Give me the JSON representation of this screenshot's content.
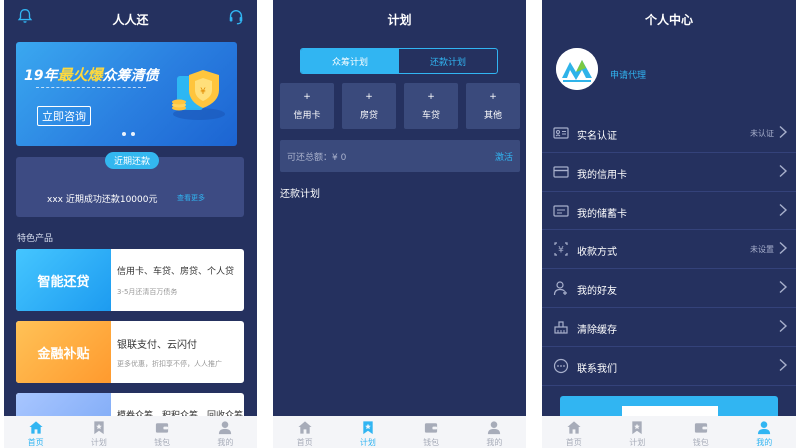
{
  "phone1": {
    "title": "人人还",
    "banner": {
      "title_prefix": "19年",
      "title_hot": "最火爆",
      "title_suffix": "众筹清债",
      "button": "立即咨询"
    },
    "repay": {
      "tag": "近期还款",
      "text": "xxx 近期成功还款10000元",
      "more": "查看更多"
    },
    "section_label": "特色产品",
    "products": [
      {
        "name": "智能还贷",
        "line1": "信用卡、车贷、房贷、个人贷",
        "line2": "3-5月还清百万债务"
      },
      {
        "name": "金融补贴",
        "line1": "银联支付、云闪付",
        "line2": "更多优惠，折扣享不停，人人推广"
      },
      {
        "name": "",
        "line1": "模券众筹、积积众筹、回收众筹",
        "line2": ""
      }
    ],
    "tabs": [
      {
        "label": "首页",
        "icon": "home-icon",
        "active": true
      },
      {
        "label": "计划",
        "icon": "bookmark-icon",
        "active": false
      },
      {
        "label": "钱包",
        "icon": "wallet-icon",
        "active": false
      },
      {
        "label": "我的",
        "icon": "user-icon",
        "active": false
      }
    ]
  },
  "phone2": {
    "title": "计划",
    "segments": [
      "众筹计划",
      "还款计划"
    ],
    "grid": [
      {
        "plus": "+",
        "label": "信用卡"
      },
      {
        "plus": "+",
        "label": "房贷"
      },
      {
        "plus": "+",
        "label": "车贷"
      },
      {
        "plus": "+",
        "label": "其他"
      }
    ],
    "balance_label": "可还总额：¥ 0",
    "balance_action": "激活",
    "plan_label": "还款计划",
    "tabs": [
      {
        "label": "首页",
        "icon": "home-icon",
        "active": false
      },
      {
        "label": "计划",
        "icon": "bookmark-icon",
        "active": true
      },
      {
        "label": "钱包",
        "icon": "wallet-icon",
        "active": false
      },
      {
        "label": "我的",
        "icon": "user-icon",
        "active": false
      }
    ]
  },
  "phone3": {
    "title": "个人中心",
    "apply": "申请代理",
    "menu": [
      {
        "label": "实名认证",
        "status": "未认证",
        "icon": "id-card-icon"
      },
      {
        "label": "我的信用卡",
        "status": "",
        "icon": "credit-card-icon"
      },
      {
        "label": "我的储蓄卡",
        "status": "",
        "icon": "debit-card-icon"
      },
      {
        "label": "收款方式",
        "status": "未设置",
        "icon": "yuan-icon"
      },
      {
        "label": "我的好友",
        "status": "",
        "icon": "friends-icon"
      },
      {
        "label": "清除缓存",
        "status": "",
        "icon": "clear-cache-icon"
      },
      {
        "label": "联系我们",
        "status": "",
        "icon": "chat-icon"
      }
    ],
    "tabs": [
      {
        "label": "首页",
        "icon": "home-icon",
        "active": false
      },
      {
        "label": "计划",
        "icon": "bookmark-icon",
        "active": false
      },
      {
        "label": "钱包",
        "icon": "wallet-icon",
        "active": false
      },
      {
        "label": "我的",
        "icon": "user-icon",
        "active": true
      }
    ]
  },
  "colors": {
    "background": "#25315f",
    "accent": "#31b5f2",
    "card": "#3d4b83"
  }
}
